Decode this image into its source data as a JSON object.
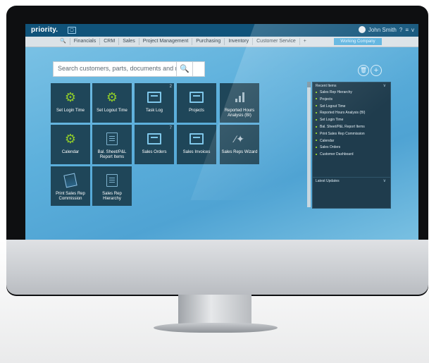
{
  "app": {
    "logo": "priority.",
    "user_name": "John Smith",
    "help_icon": "?",
    "menu_icon": "≡",
    "chevron_icon": "v"
  },
  "menu": {
    "search_icon": "🔍",
    "items": [
      "Financials",
      "CRM",
      "Sales",
      "Project Management",
      "Purchasing",
      "Inventory",
      "Customer Service",
      "+"
    ],
    "company_label": "Working Company"
  },
  "search": {
    "placeholder": "Search customers, parts, documents and more",
    "icon": "🔍"
  },
  "tiles": [
    {
      "label": "Set Login Time",
      "icon": "gear-icon",
      "badge": ""
    },
    {
      "label": "Set Logout Time",
      "icon": "gear-icon",
      "badge": ""
    },
    {
      "label": "Task Log",
      "icon": "form-icon",
      "badge": "2"
    },
    {
      "label": "Projects",
      "icon": "form-icon",
      "badge": ""
    },
    {
      "label": "Reported Hours Analysis (BI)",
      "icon": "bar-chart-icon",
      "badge": ""
    },
    {
      "label": "Calendar",
      "icon": "gear-icon",
      "badge": ""
    },
    {
      "label": "Bal. Sheet/P&L Report Items",
      "icon": "report-icon",
      "badge": ""
    },
    {
      "label": "Sales Orders",
      "icon": "form-icon",
      "badge": "7"
    },
    {
      "label": "Sales Invoices",
      "icon": "form-icon",
      "badge": ""
    },
    {
      "label": "Sales Reps Wizard",
      "icon": "wand-icon",
      "badge": ""
    },
    {
      "label": "Print Sales Rep Commission",
      "icon": "print-icon",
      "badge": ""
    },
    {
      "label": "Sales Rep Hierarchy",
      "icon": "report-icon",
      "badge": ""
    }
  ],
  "panel": {
    "recent_title": "Recent Items",
    "recent_items": [
      "Sales Rep Hierarchy",
      "Projects",
      "Set Logout Time",
      "Reported Hours Analysis (BI)",
      "Set Login Time",
      "Bal. Sheet/P&L Report Items",
      "Print Sales Rep Commission",
      "Calendar",
      "Sales Orders",
      "Customer Dashboard"
    ],
    "latest_title": "Latest Updates"
  }
}
